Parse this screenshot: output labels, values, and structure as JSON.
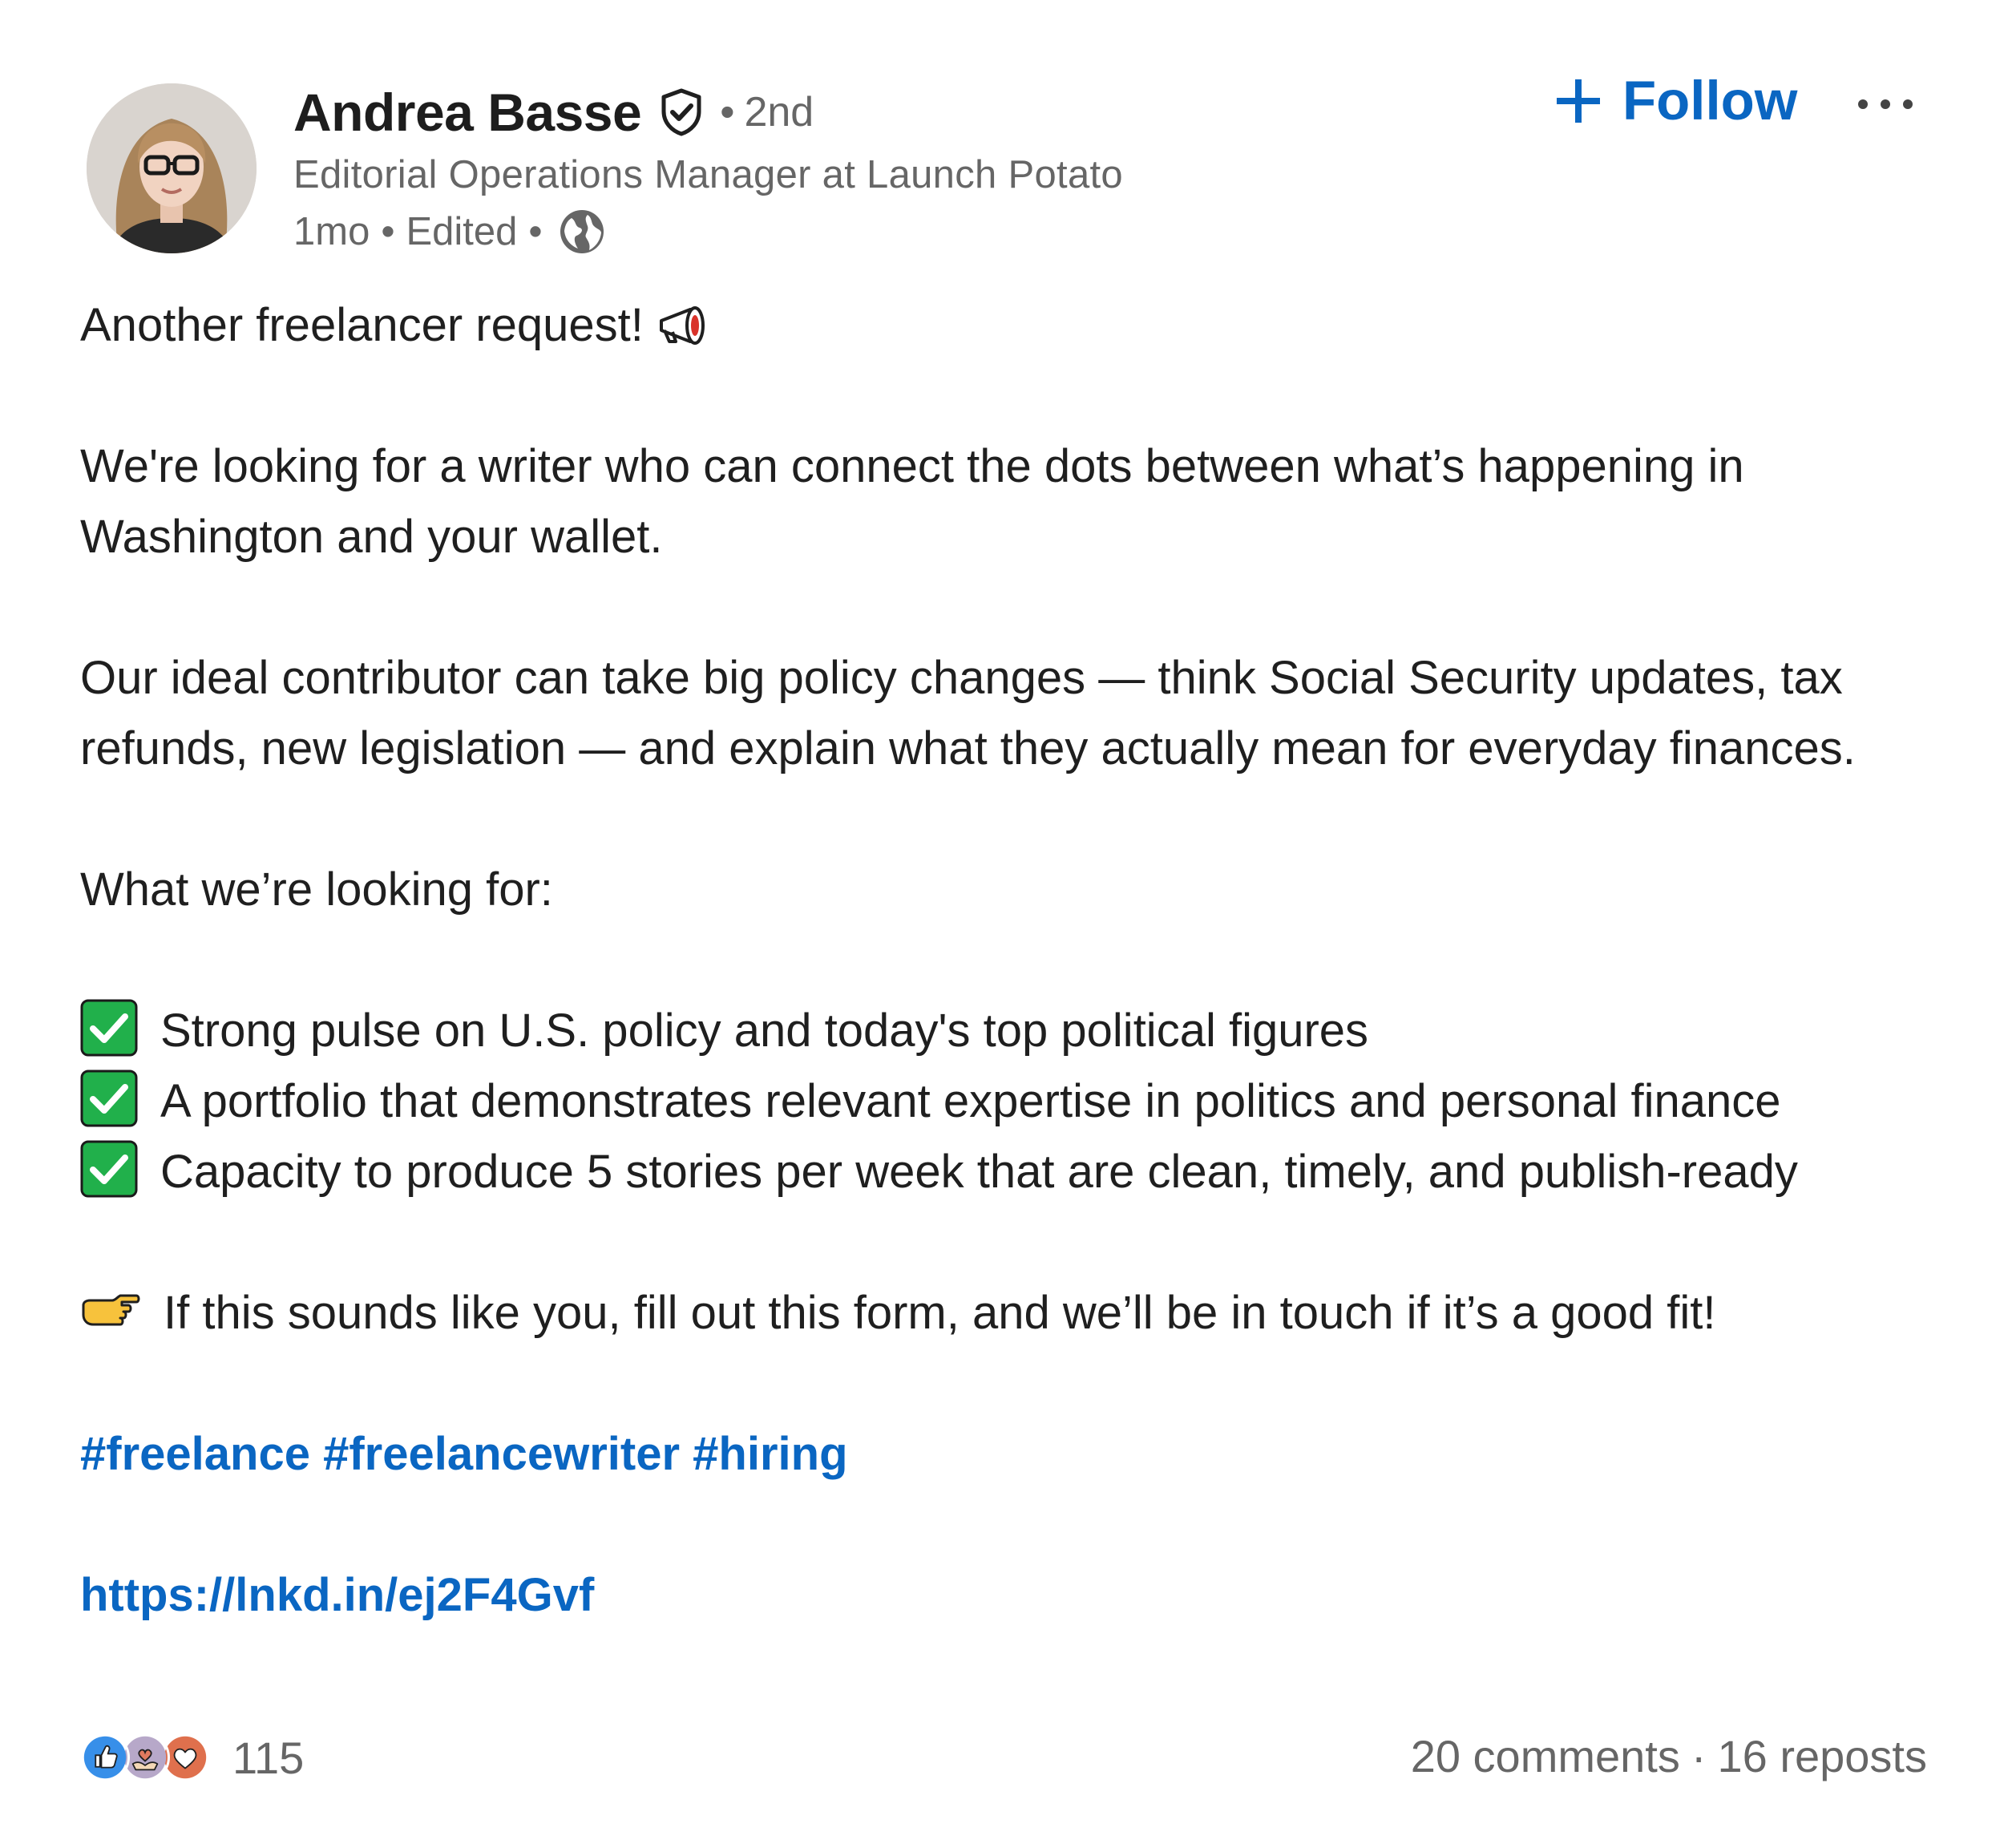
{
  "author": {
    "name": "Andrea Basse",
    "degree": "2nd",
    "degree_separator": "•",
    "headline": "Editorial Operations Manager at Launch Potato",
    "time": "1mo",
    "edited": "Edited",
    "meta_separator": "•",
    "verified_icon": "shield-check-icon",
    "visibility_icon": "globe-icon"
  },
  "actions": {
    "follow_label": "Follow",
    "follow_icon": "plus-icon",
    "more_icon": "ellipsis-icon"
  },
  "post": {
    "intro": "Another freelancer request!",
    "paragraph1": "We're looking for a writer who can connect the dots between what’s happening in Washington and your wallet.",
    "paragraph2": "Our ideal contributor can take big policy changes — think Social Security updates, tax refunds, new legislation — and explain what they actually mean for everyday finances.",
    "list_heading": "What we’re looking for:",
    "bullets": [
      "Strong pulse on U.S. policy and today's top political figures",
      "A portfolio that demonstrates relevant expertise in politics and personal finance",
      "Capacity to produce 5 stories per week that are clean, timely, and publish-ready"
    ],
    "cta": "If this sounds like you, fill out this form, and we’ll be in touch if it’s a good fit!",
    "hashtags": [
      "#freelance",
      "#freelancewriter",
      "#hiring"
    ],
    "link": "https://lnkd.in/ej2F4Gvf"
  },
  "footer": {
    "reactions_count": "115",
    "comments": "20 comments",
    "counts_separator": "·",
    "reposts": "16 reposts"
  },
  "colors": {
    "link_blue": "#0a66c2",
    "secondary_text": "#666666",
    "check_green": "#21b04b",
    "love_red": "#df704d"
  }
}
